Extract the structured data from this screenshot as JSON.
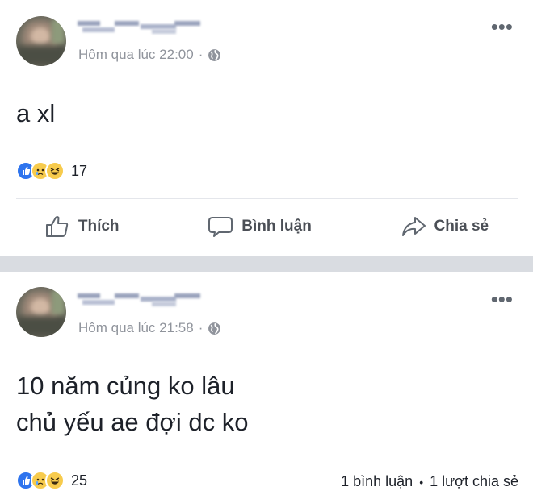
{
  "posts": [
    {
      "author_blurred": true,
      "timestamp": "Hôm qua lúc 22:00",
      "separator": "·",
      "privacy_icon": "globe-icon",
      "more_label": "•••",
      "text_lines": [
        "a xl"
      ],
      "reactions": {
        "types": [
          "like",
          "sad",
          "haha"
        ],
        "count": "17"
      },
      "actions": {
        "like_label": "Thích",
        "comment_label": "Bình luận",
        "share_label": "Chia sẻ"
      }
    },
    {
      "author_blurred": true,
      "timestamp": "Hôm qua lúc 21:58",
      "separator": "·",
      "privacy_icon": "globe-icon",
      "more_label": "•••",
      "text_lines": [
        "10 năm củng ko lâu",
        "chủ yếu ae đợi dc ko"
      ],
      "reactions": {
        "types": [
          "like",
          "sad",
          "haha"
        ],
        "count": "25"
      },
      "engagement": {
        "comments": "1 bình luận",
        "dot": "•",
        "shares": "1 lượt chia sẻ"
      }
    }
  ],
  "colors": {
    "separator": "#d9dce1",
    "meta_text": "#90949c",
    "like_blue": "#2e74ee",
    "emoji_yellow": "#f7cb4d"
  }
}
